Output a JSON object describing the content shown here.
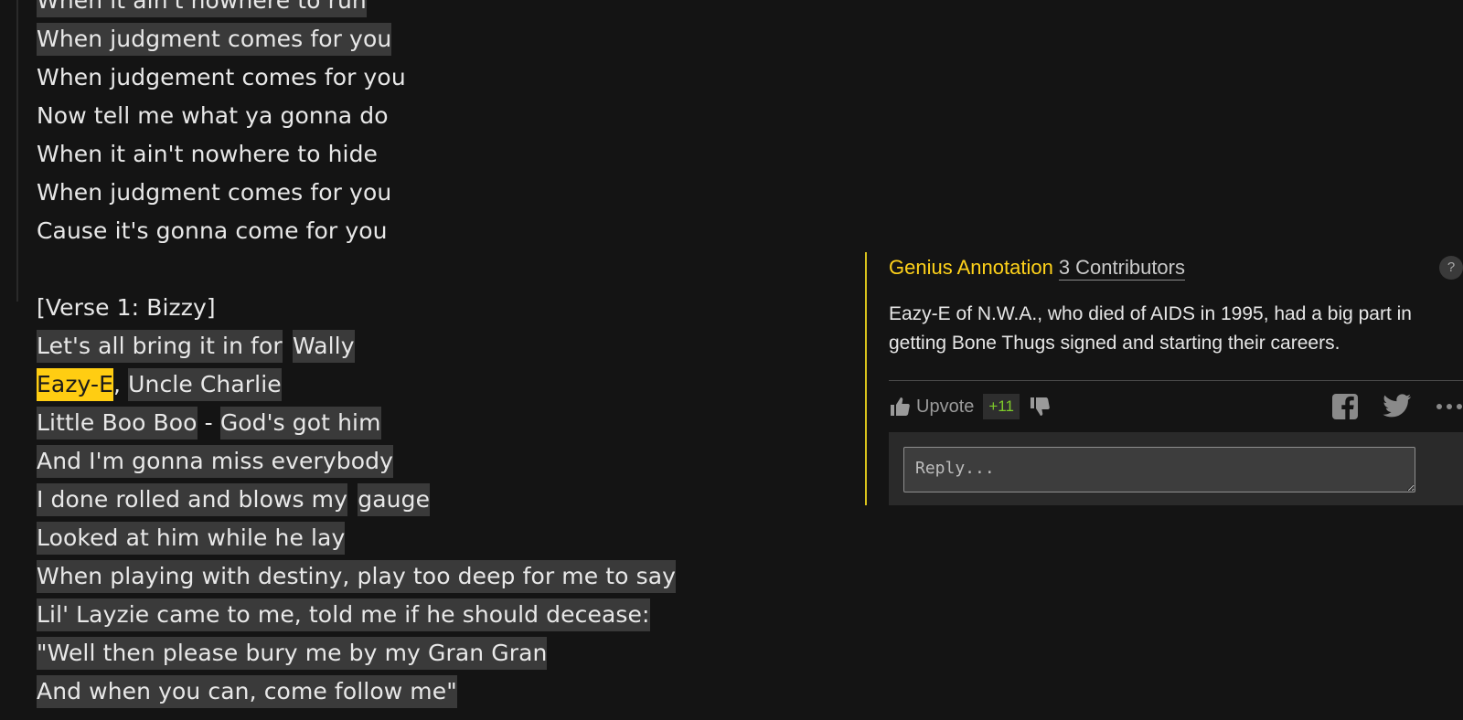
{
  "lyrics": {
    "lines": [
      [
        {
          "text": "When it ain't nowhere to run",
          "hl": true
        }
      ],
      [
        {
          "text": "When judgment comes for you",
          "hl": true
        }
      ],
      [
        {
          "text": "When judgement comes for you",
          "hl": false
        }
      ],
      [
        {
          "text": "Now tell me what ya gonna do",
          "hl": false
        }
      ],
      [
        {
          "text": "When it ain't nowhere to hide",
          "hl": false
        }
      ],
      [
        {
          "text": "When judgment comes for you",
          "hl": false
        }
      ],
      [
        {
          "text": "Cause it's gonna come for you",
          "hl": false
        }
      ],
      [],
      [
        {
          "text": "[Verse 1: Bizzy]",
          "hl": false
        }
      ],
      [
        {
          "text": "Let's all bring it in for",
          "hl": true
        },
        {
          "text": "Wally",
          "hl": true
        }
      ],
      [
        {
          "text": "Eazy-E",
          "hl": "active"
        },
        {
          "text": ", ",
          "hl": false,
          "plain": true
        },
        {
          "text": "Uncle Charlie",
          "hl": true
        }
      ],
      [
        {
          "text": "Little Boo Boo",
          "hl": true
        },
        {
          "text": " - ",
          "hl": false,
          "plain": true
        },
        {
          "text": "God's got him",
          "hl": true
        }
      ],
      [
        {
          "text": "And I'm gonna miss everybody",
          "hl": true
        }
      ],
      [
        {
          "text": "I done rolled and blows my",
          "hl": true
        },
        {
          "text": "gauge",
          "hl": true
        }
      ],
      [
        {
          "text": "Looked at him while he lay",
          "hl": true
        }
      ],
      [
        {
          "text": "When playing with destiny, play too deep for me to say",
          "hl": true
        }
      ],
      [
        {
          "text": "Lil' Layzie came to me, told me if he should decease:",
          "hl": true
        }
      ],
      [
        {
          "text": "\"Well then please bury me by my Gran Gran",
          "hl": true
        }
      ],
      [
        {
          "text": "And when you can, come follow me\"",
          "hl": true
        }
      ]
    ]
  },
  "annotation": {
    "title": "Genius Annotation",
    "contributors": "3 Contributors",
    "help": "?",
    "body": "Eazy-E of N.W.A., who died of AIDS in 1995, had a big part in getting Bone Thugs signed and starting their careers.",
    "upvote_label": "Upvote",
    "score": "+11",
    "reply_placeholder": "Reply..."
  },
  "colors": {
    "background": "#141414",
    "highlight": "#3a3a3a",
    "active_highlight": "#ffcd12",
    "accent_yellow": "#ffd21a",
    "score_green": "#7ecb2a"
  },
  "icons": [
    "thumbs-up-icon",
    "thumbs-down-icon",
    "facebook-icon",
    "twitter-icon",
    "more-icon"
  ]
}
